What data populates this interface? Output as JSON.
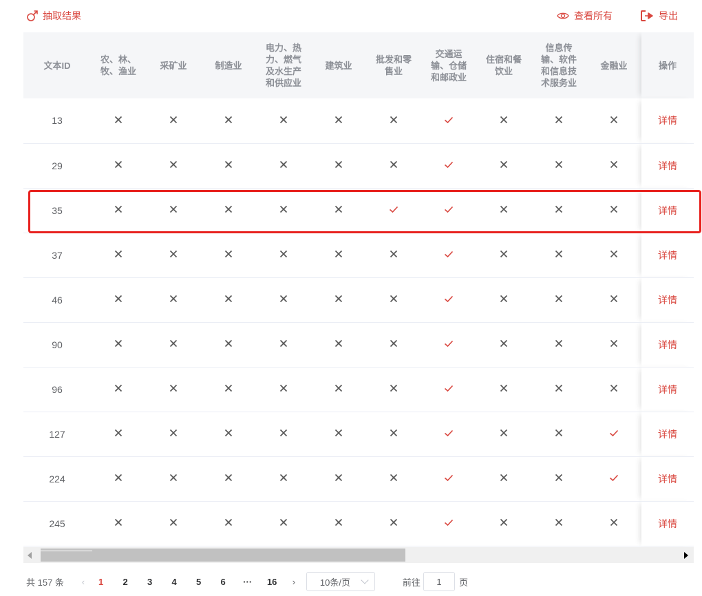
{
  "header": {
    "title": "抽取结果",
    "view_all": "查看所有",
    "export": "导出"
  },
  "table": {
    "columns": [
      "文本ID",
      "农、林、牧、渔业",
      "采矿业",
      "制造业",
      "电力、热力、燃气及水生产和供应业",
      "建筑业",
      "批发和零售业",
      "交通运输、仓储和邮政业",
      "住宿和餐饮业",
      "信息传输、软件和信息技术服务业",
      "金融业",
      "操作"
    ],
    "rows": [
      {
        "id": "13",
        "flags": [
          false,
          false,
          false,
          false,
          false,
          false,
          true,
          false,
          false,
          false
        ],
        "action": "详情"
      },
      {
        "id": "29",
        "flags": [
          false,
          false,
          false,
          false,
          false,
          false,
          true,
          false,
          false,
          false
        ],
        "action": "详情"
      },
      {
        "id": "35",
        "flags": [
          false,
          false,
          false,
          false,
          false,
          true,
          true,
          false,
          false,
          false
        ],
        "action": "详情"
      },
      {
        "id": "37",
        "flags": [
          false,
          false,
          false,
          false,
          false,
          false,
          true,
          false,
          false,
          false
        ],
        "action": "详情"
      },
      {
        "id": "46",
        "flags": [
          false,
          false,
          false,
          false,
          false,
          false,
          true,
          false,
          false,
          false
        ],
        "action": "详情"
      },
      {
        "id": "90",
        "flags": [
          false,
          false,
          false,
          false,
          false,
          false,
          true,
          false,
          false,
          false
        ],
        "action": "详情"
      },
      {
        "id": "96",
        "flags": [
          false,
          false,
          false,
          false,
          false,
          false,
          true,
          false,
          false,
          false
        ],
        "action": "详情"
      },
      {
        "id": "127",
        "flags": [
          false,
          false,
          false,
          false,
          false,
          false,
          true,
          false,
          false,
          true
        ],
        "action": "详情"
      },
      {
        "id": "224",
        "flags": [
          false,
          false,
          false,
          false,
          false,
          false,
          true,
          false,
          false,
          true
        ],
        "action": "详情"
      },
      {
        "id": "245",
        "flags": [
          false,
          false,
          false,
          false,
          false,
          false,
          true,
          false,
          false,
          false
        ],
        "action": "详情"
      }
    ],
    "highlighted_row_id": "35"
  },
  "pagination": {
    "total": "共 157 条",
    "pages": [
      "1",
      "2",
      "3",
      "4",
      "5",
      "6",
      "···",
      "16"
    ],
    "current": "1",
    "page_size": "10条/页",
    "goto_prefix": "前往",
    "goto_value": "1",
    "goto_suffix": "页"
  },
  "icons": {
    "title": "male-symbol-icon",
    "view_all": "eye-icon",
    "export": "sign-out-icon",
    "true_mark": "check-icon",
    "false_mark": "cross-icon"
  },
  "colors": {
    "accent": "#d9473f",
    "check": "#d9473f",
    "cross": "#555555",
    "highlight_border": "#e8221f",
    "header_bg": "#f5f6f8"
  }
}
